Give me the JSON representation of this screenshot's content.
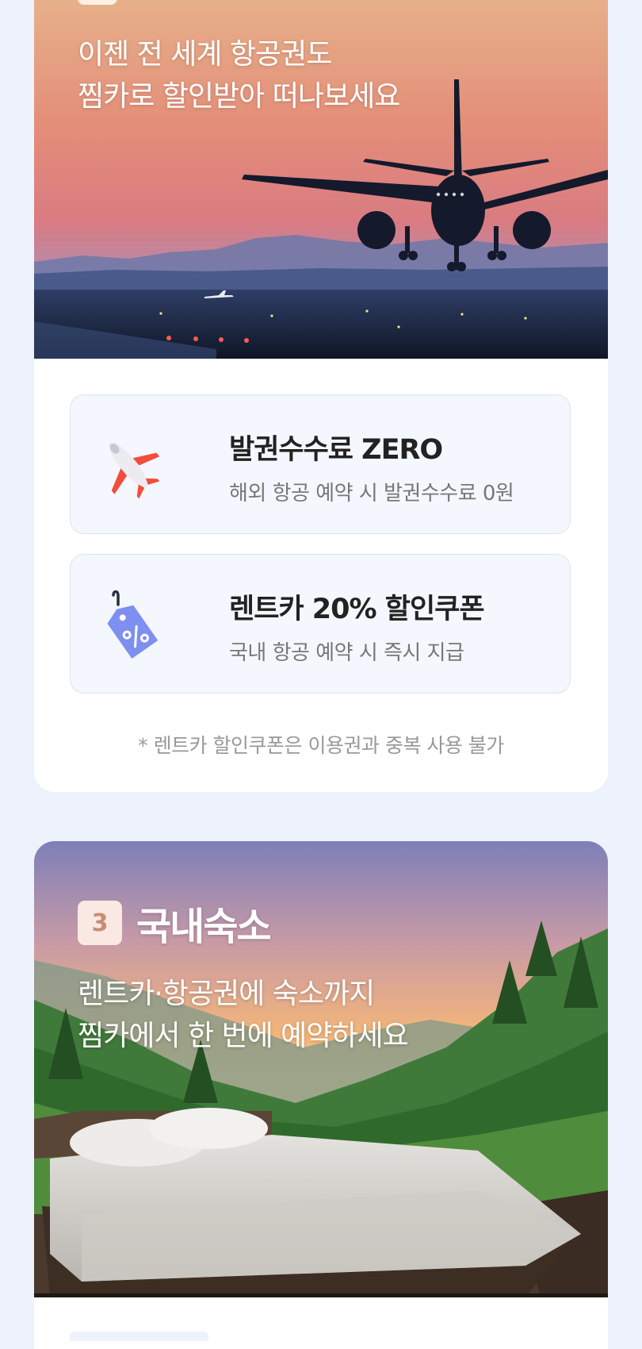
{
  "flight_section": {
    "headline": [
      "이젠 전 세계 항공권도",
      "찜카로 할인받아 떠나보세요"
    ],
    "benefits": [
      {
        "icon": "airplane-icon",
        "title": "발권수수료 ZERO",
        "description": "해외 항공 예약 시 발권수수료 0원"
      },
      {
        "icon": "discount-tag-icon",
        "title": "렌트카 20% 할인쿠폰",
        "description": "국내 항공 예약 시 즉시 지급"
      }
    ],
    "footnote": "* 렌트카 할인쿠폰은 이용권과 중복 사용 불가"
  },
  "stay_section": {
    "number": "3",
    "title": "국내숙소",
    "headline": [
      "렌트카·항공권에 숙소까지",
      "찜카에서 한 번에 예약하세요"
    ]
  },
  "colors": {
    "page_bg": "#eef2fc",
    "card_bg": "#ffffff",
    "benefit_bg": "#f4f7fd",
    "badge_bg": "#f9e9e2",
    "badge_text": "#c98b74"
  }
}
